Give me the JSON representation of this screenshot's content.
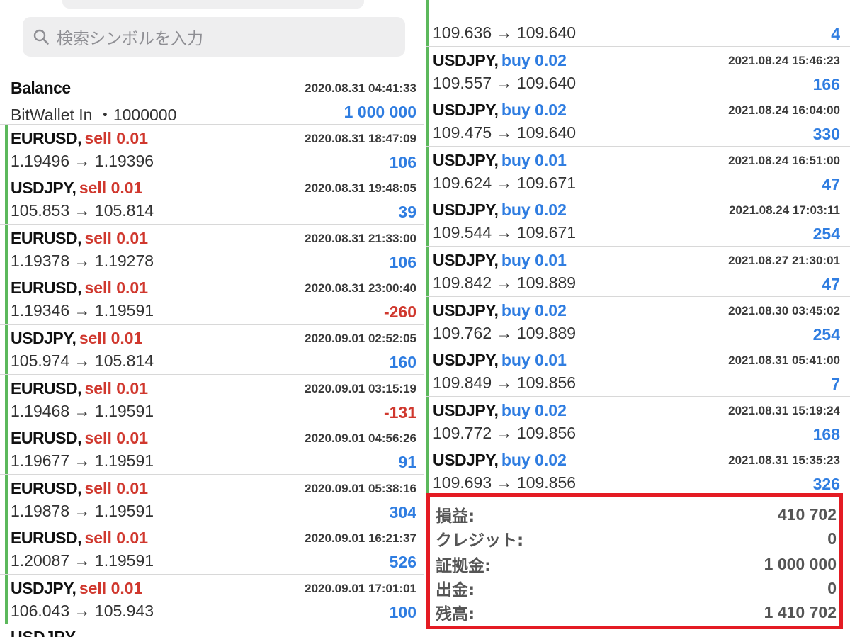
{
  "search": {
    "placeholder": "検索シンボルを入力"
  },
  "left_balance": {
    "label": "Balance",
    "time": "2020.08.31 04:41:33",
    "description": "BitWallet In ・1000000",
    "amount": "1 000 000"
  },
  "left_trades": [
    {
      "symbol": "EURUSD,",
      "action": "sell 0.01",
      "time": "2020.08.31 18:47:09",
      "prices": "1.19496 → 1.19396",
      "profit": "106"
    },
    {
      "symbol": "USDJPY,",
      "action": "sell 0.01",
      "time": "2020.08.31 19:48:05",
      "prices": "105.853 → 105.814",
      "profit": "39"
    },
    {
      "symbol": "EURUSD,",
      "action": "sell 0.01",
      "time": "2020.08.31 21:33:00",
      "prices": "1.19378 → 1.19278",
      "profit": "106"
    },
    {
      "symbol": "EURUSD,",
      "action": "sell 0.01",
      "time": "2020.08.31 23:00:40",
      "prices": "1.19346 → 1.19591",
      "profit": "-260"
    },
    {
      "symbol": "USDJPY,",
      "action": "sell 0.01",
      "time": "2020.09.01 02:52:05",
      "prices": "105.974 → 105.814",
      "profit": "160"
    },
    {
      "symbol": "EURUSD,",
      "action": "sell 0.01",
      "time": "2020.09.01 03:15:19",
      "prices": "1.19468 → 1.19591",
      "profit": "-131"
    },
    {
      "symbol": "EURUSD,",
      "action": "sell 0.01",
      "time": "2020.09.01 04:56:26",
      "prices": "1.19677 → 1.19591",
      "profit": "91"
    },
    {
      "symbol": "EURUSD,",
      "action": "sell 0.01",
      "time": "2020.09.01 05:38:16",
      "prices": "1.19878 → 1.19591",
      "profit": "304"
    },
    {
      "symbol": "EURUSD,",
      "action": "sell 0.01",
      "time": "2020.09.01 16:21:37",
      "prices": "1.20087 → 1.19591",
      "profit": "526"
    },
    {
      "symbol": "USDJPY,",
      "action": "sell 0.01",
      "time": "2020.09.01 17:01:01",
      "prices": "106.043 → 105.943",
      "profit": "100"
    }
  ],
  "right_trades": [
    {
      "symbol": "",
      "action": "",
      "time": "",
      "prices": "109.636 → 109.640",
      "profit": "4"
    },
    {
      "symbol": "USDJPY,",
      "action": "buy 0.02",
      "time": "2021.08.24 15:46:23",
      "prices": "109.557 → 109.640",
      "profit": "166"
    },
    {
      "symbol": "USDJPY,",
      "action": "buy 0.02",
      "time": "2021.08.24 16:04:00",
      "prices": "109.475 → 109.640",
      "profit": "330"
    },
    {
      "symbol": "USDJPY,",
      "action": "buy 0.01",
      "time": "2021.08.24 16:51:00",
      "prices": "109.624 → 109.671",
      "profit": "47"
    },
    {
      "symbol": "USDJPY,",
      "action": "buy 0.02",
      "time": "2021.08.24 17:03:11",
      "prices": "109.544 → 109.671",
      "profit": "254"
    },
    {
      "symbol": "USDJPY,",
      "action": "buy 0.01",
      "time": "2021.08.27 21:30:01",
      "prices": "109.842 → 109.889",
      "profit": "47"
    },
    {
      "symbol": "USDJPY,",
      "action": "buy 0.02",
      "time": "2021.08.30 03:45:02",
      "prices": "109.762 → 109.889",
      "profit": "254"
    },
    {
      "symbol": "USDJPY,",
      "action": "buy 0.01",
      "time": "2021.08.31 05:41:00",
      "prices": "109.849 → 109.856",
      "profit": "7"
    },
    {
      "symbol": "USDJPY,",
      "action": "buy 0.02",
      "time": "2021.08.31 15:19:24",
      "prices": "109.772 → 109.856",
      "profit": "168"
    },
    {
      "symbol": "USDJPY,",
      "action": "buy 0.02",
      "time": "2021.08.31 15:35:23",
      "prices": "109.693 → 109.856",
      "profit": "326"
    }
  ],
  "summary": {
    "profit_label": "損益:",
    "profit_value": "410 702",
    "credit_label": "クレジット:",
    "credit_value": "0",
    "margin_label": "証拠金:",
    "margin_value": "1 000 000",
    "withdrawal_label": "出金:",
    "withdrawal_value": "0",
    "balance_label": "残高:",
    "balance_value": "1 410 702"
  },
  "partial_left_bottom": {
    "symbol": "USDJPY,"
  },
  "colors": {
    "sell": "#d0382e",
    "buy": "#2f7de1",
    "accent_bar": "#5cb85c",
    "highlight_box": "#e41b23"
  }
}
